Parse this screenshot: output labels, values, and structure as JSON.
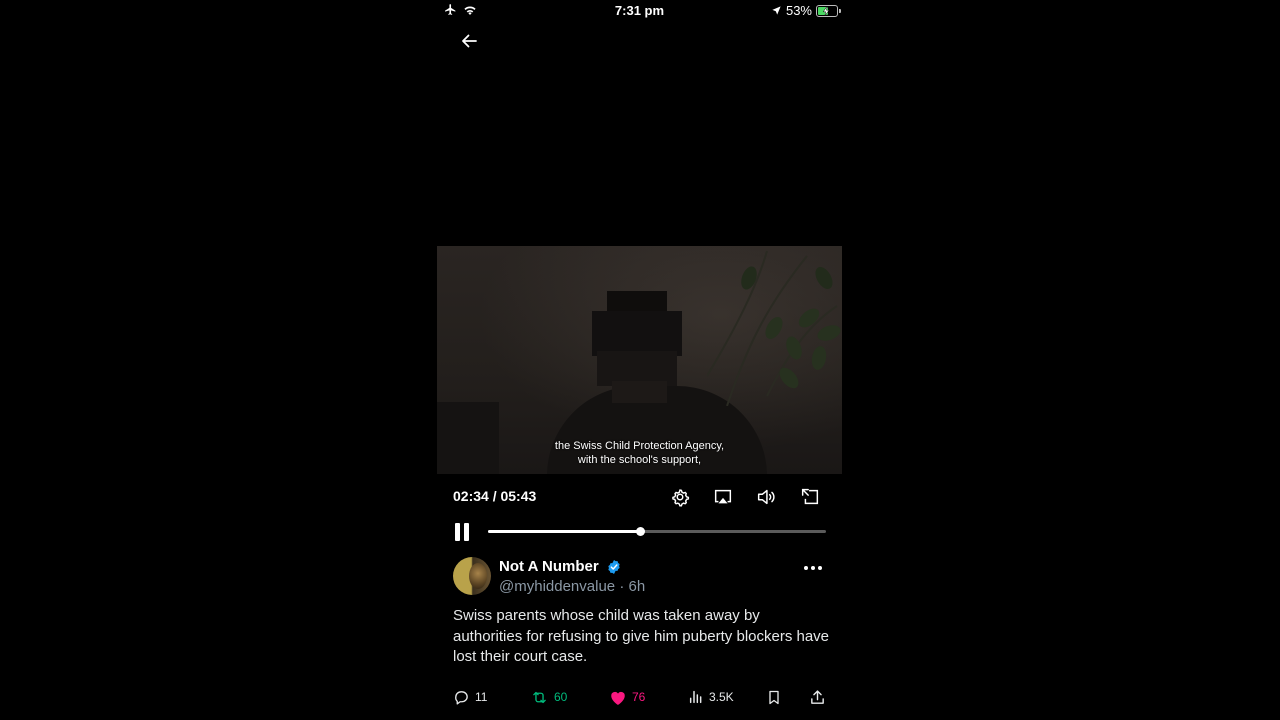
{
  "status_bar": {
    "time": "7:31 pm",
    "battery_percent_label": "53%",
    "battery_level": 0.53,
    "icons": [
      "airplane-icon",
      "wifi-icon",
      "location-arrow-icon",
      "battery-charging-icon"
    ]
  },
  "nav": {
    "back_icon": "arrow-left-icon"
  },
  "video": {
    "subtitle_line1": "the Swiss Child Protection Agency,",
    "subtitle_line2": "with the school's support,",
    "time_display": "02:34 / 05:43",
    "progress_fraction": 0.45,
    "controls": [
      "gear-icon",
      "airplay-icon",
      "volume-icon",
      "pip-icon"
    ]
  },
  "tweet": {
    "display_name": "Not A Number",
    "handle": "@myhiddenvalue",
    "separator": "·",
    "age": "6h",
    "verified_color": "#1d9bf0",
    "text": "Swiss parents whose child was taken away by authorities for refusing to give him puberty blockers have lost their court case."
  },
  "actions": {
    "replies": "11",
    "retweets": "60",
    "likes": "76",
    "views": "3.5K",
    "colors": {
      "retweet": "#00ba7c",
      "like": "#f91880",
      "neutral": "#e7e9ea"
    }
  }
}
